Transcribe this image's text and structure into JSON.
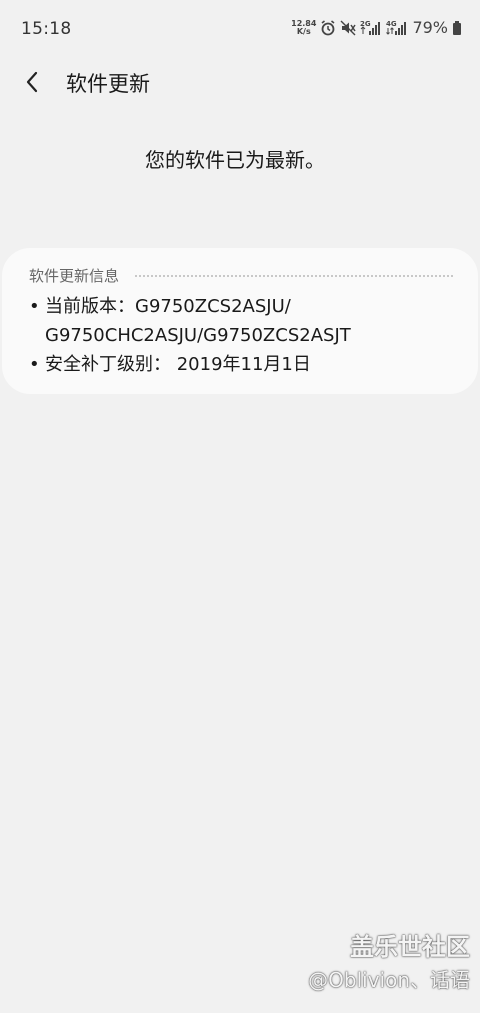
{
  "status_bar": {
    "time": "15:18",
    "net_speed_value": "12.84",
    "net_speed_unit": "K/s",
    "net_type_1": "2G",
    "net_type_2": "4G",
    "battery_percent": "79%",
    "icons": [
      "alarm-icon",
      "mute-icon",
      "signal-2g-icon",
      "signal-4g-icon",
      "battery-icon"
    ]
  },
  "header": {
    "back_icon": "chevron-left-icon",
    "title": "软件更新"
  },
  "main": {
    "status_message": "您的软件已为最新。"
  },
  "info_card": {
    "title": "软件更新信息",
    "items": [
      {
        "bullet": "•",
        "text": "当前版本：G9750ZCS2ASJU/\nG9750CHC2ASJU/G9750ZCS2ASJT"
      },
      {
        "bullet": "•",
        "text": "安全补丁级别： 2019年11月1日"
      }
    ]
  },
  "watermark": {
    "community": "盖乐世社区",
    "user": "@Oblivion、话语"
  }
}
